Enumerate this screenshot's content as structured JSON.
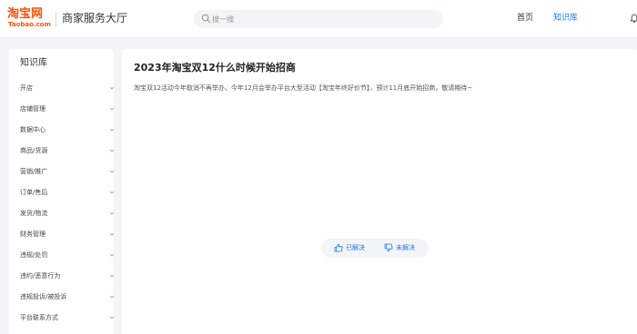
{
  "header": {
    "logo_text": "淘宝网",
    "logo_sub": "Taobao.com",
    "app_title": "商家服务大厅",
    "search_placeholder": "搜一搜",
    "nav": {
      "home": "首页",
      "knowledge_base": "知识库"
    }
  },
  "sidebar": {
    "title": "知识库",
    "items": [
      {
        "label": "开店"
      },
      {
        "label": "店铺管理"
      },
      {
        "label": "数据中心"
      },
      {
        "label": "商品/货源"
      },
      {
        "label": "营销/推广"
      },
      {
        "label": "订单/售后"
      },
      {
        "label": "发货/物流"
      },
      {
        "label": "财务管理"
      },
      {
        "label": "违规/处罚"
      },
      {
        "label": "违约/恶意行为"
      },
      {
        "label": "违规投诉/被投诉"
      },
      {
        "label": "平台联系方式"
      }
    ]
  },
  "article": {
    "title": "2023年淘宝双12什么时候开始招商",
    "body": "淘宝双12活动今年取消不再举办，今年12月会举办平台大型活动【淘宝年终好价节】，预计11月底开始招商，敬请期待~"
  },
  "feedback": {
    "resolved_label": "已解决",
    "unresolved_label": "未解决"
  },
  "colors": {
    "brand": "#ff5000",
    "accent": "#1677ff",
    "background": "#f4f5f7"
  }
}
